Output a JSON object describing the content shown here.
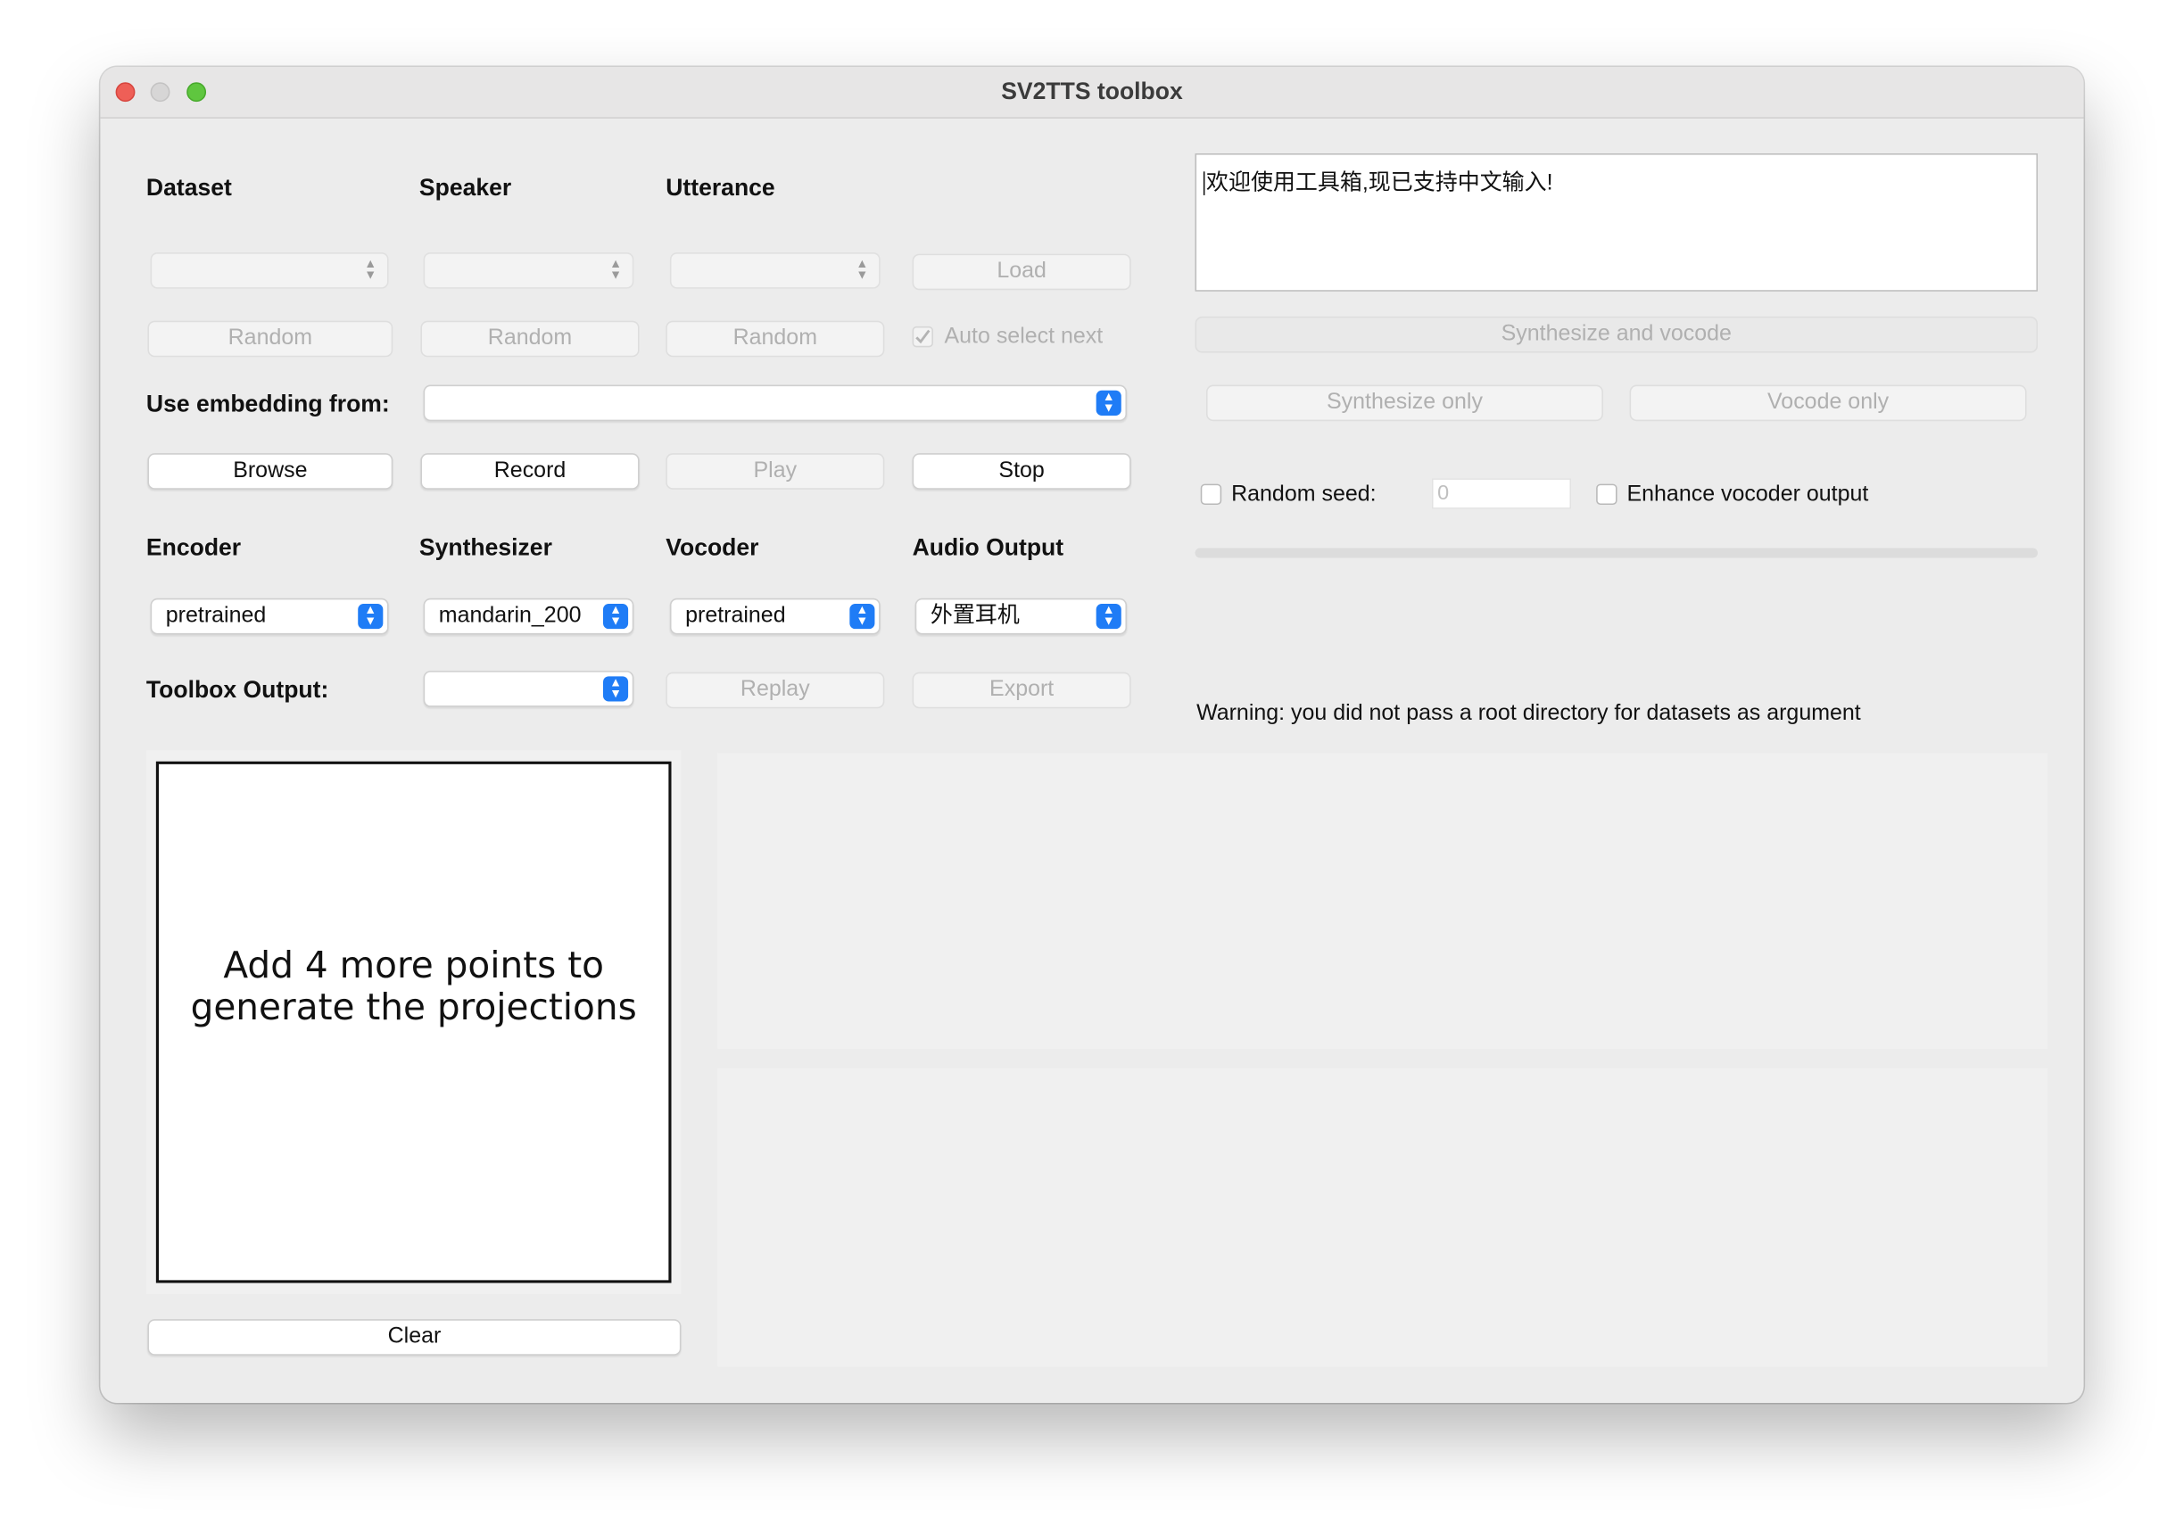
{
  "window": {
    "title": "SV2TTS toolbox"
  },
  "dataset_section": {
    "dataset_label": "Dataset",
    "speaker_label": "Speaker",
    "utterance_label": "Utterance",
    "load_button": "Load",
    "random_dataset": "Random",
    "random_speaker": "Random",
    "random_utterance": "Random",
    "auto_select_label": "Auto select next",
    "auto_select_checked": true
  },
  "embedding": {
    "label": "Use embedding from:",
    "browse": "Browse",
    "record": "Record",
    "play": "Play",
    "stop": "Stop"
  },
  "models": {
    "encoder_label": "Encoder",
    "synthesizer_label": "Synthesizer",
    "vocoder_label": "Vocoder",
    "audio_output_label": "Audio Output",
    "encoder_value": "pretrained",
    "synthesizer_value": "mandarin_200",
    "vocoder_value": "pretrained",
    "audio_output_value": "外置耳机"
  },
  "toolbox_output": {
    "label": "Toolbox Output:",
    "replay": "Replay",
    "export": "Export"
  },
  "projections": {
    "message_line1": "Add 4 more points to",
    "message_line2": "generate the projections",
    "clear": "Clear"
  },
  "synthesis": {
    "text": "欢迎使用工具箱,现已支持中文输入!",
    "synthesize_and_vocode": "Synthesize and vocode",
    "synthesize_only": "Synthesize only",
    "vocode_only": "Vocode only",
    "random_seed_label": "Random seed:",
    "random_seed_value": "0",
    "enhance_label": "Enhance vocoder output",
    "warning": "Warning: you did not pass a root directory for datasets as argument"
  },
  "colors": {
    "accent": "#1f7cf6",
    "window_bg": "#ececec"
  }
}
